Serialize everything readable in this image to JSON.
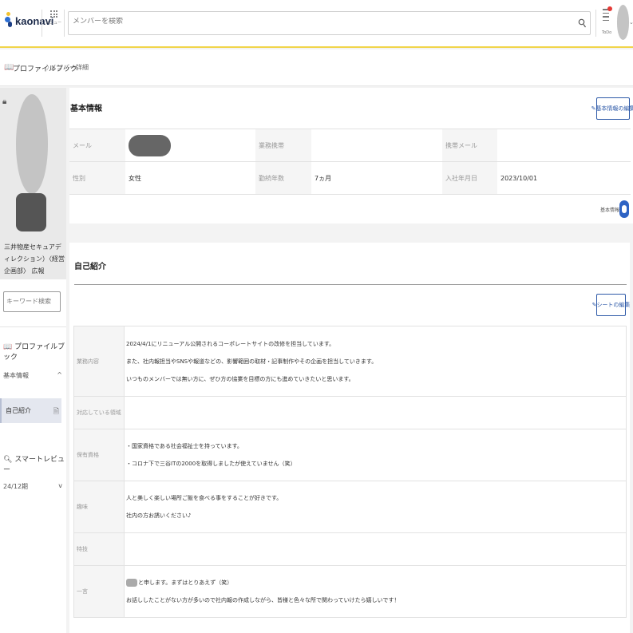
{
  "app": {
    "logo_text": "kaonavi",
    "menu_label": "メニュー",
    "search_placeholder": "メンバーを検索",
    "todo_label": "ToDo"
  },
  "breadcrumb": {
    "root": "プロファイルブック",
    "separator": "〉",
    "current": "メンバー詳細"
  },
  "sidebar": {
    "department": "三井物産セキュアディレクション）〈経営企画部〉 広報",
    "keyword_placeholder": "キーワード検索",
    "nav": {
      "profile_book": "プロファイルブック",
      "basic_info": "基本情報",
      "self_intro": "自己紹介",
      "smart_review": "スマートレビュー",
      "period": "24/12期"
    }
  },
  "basic_info": {
    "title": "基本情報",
    "edit_button": "基本情報の編集",
    "rows": [
      [
        {
          "label": "メール",
          "value": ""
        },
        {
          "label": "業務携帯",
          "value": ""
        },
        {
          "label": "携帯メール",
          "value": ""
        }
      ],
      [
        {
          "label": "性別",
          "value": "女性"
        },
        {
          "label": "勤続年数",
          "value": "7ヵ月"
        },
        {
          "label": "入社年月日",
          "value": "2023/10/01"
        }
      ]
    ],
    "toggle_label": "基本情報表示"
  },
  "self_intro": {
    "title": "自己紹介",
    "edit_button": "シートの編集",
    "rows": [
      {
        "label": "業務内容",
        "lines": [
          "2024/4/1にリニューアル公開されるコーポレートサイトの改修を担当しています。",
          "また、社内報担当やSNSや報道などの、影響範囲の取材・記事制作やその企画を担当していきます。",
          "いつものメンバーでは無い方に、ぜひ方の協業を目標の方にも進めていきたいと思います。"
        ]
      },
      {
        "label": "対応している領域",
        "lines": []
      },
      {
        "label": "保有資格",
        "lines": [
          "・国家資格である社会福祉士を持っています。",
          "・コロナ下で三谷ITの2000を取得しましたが使えていません（笑）"
        ]
      },
      {
        "label": "趣味",
        "lines": [
          "人と美しく楽しい場所ご飯を食べる事をすることが好きです。",
          "社内の方お誘いください♪"
        ]
      },
      {
        "label": "特技",
        "lines": []
      },
      {
        "label": "一言",
        "lines": [
          "と申します。まずはとりあえず（笑）",
          "お話ししたことがない方が多いので社内報の作成しながら、皆様と色々な所で関わっていけたら嬉しいです！"
        ]
      }
    ]
  }
}
